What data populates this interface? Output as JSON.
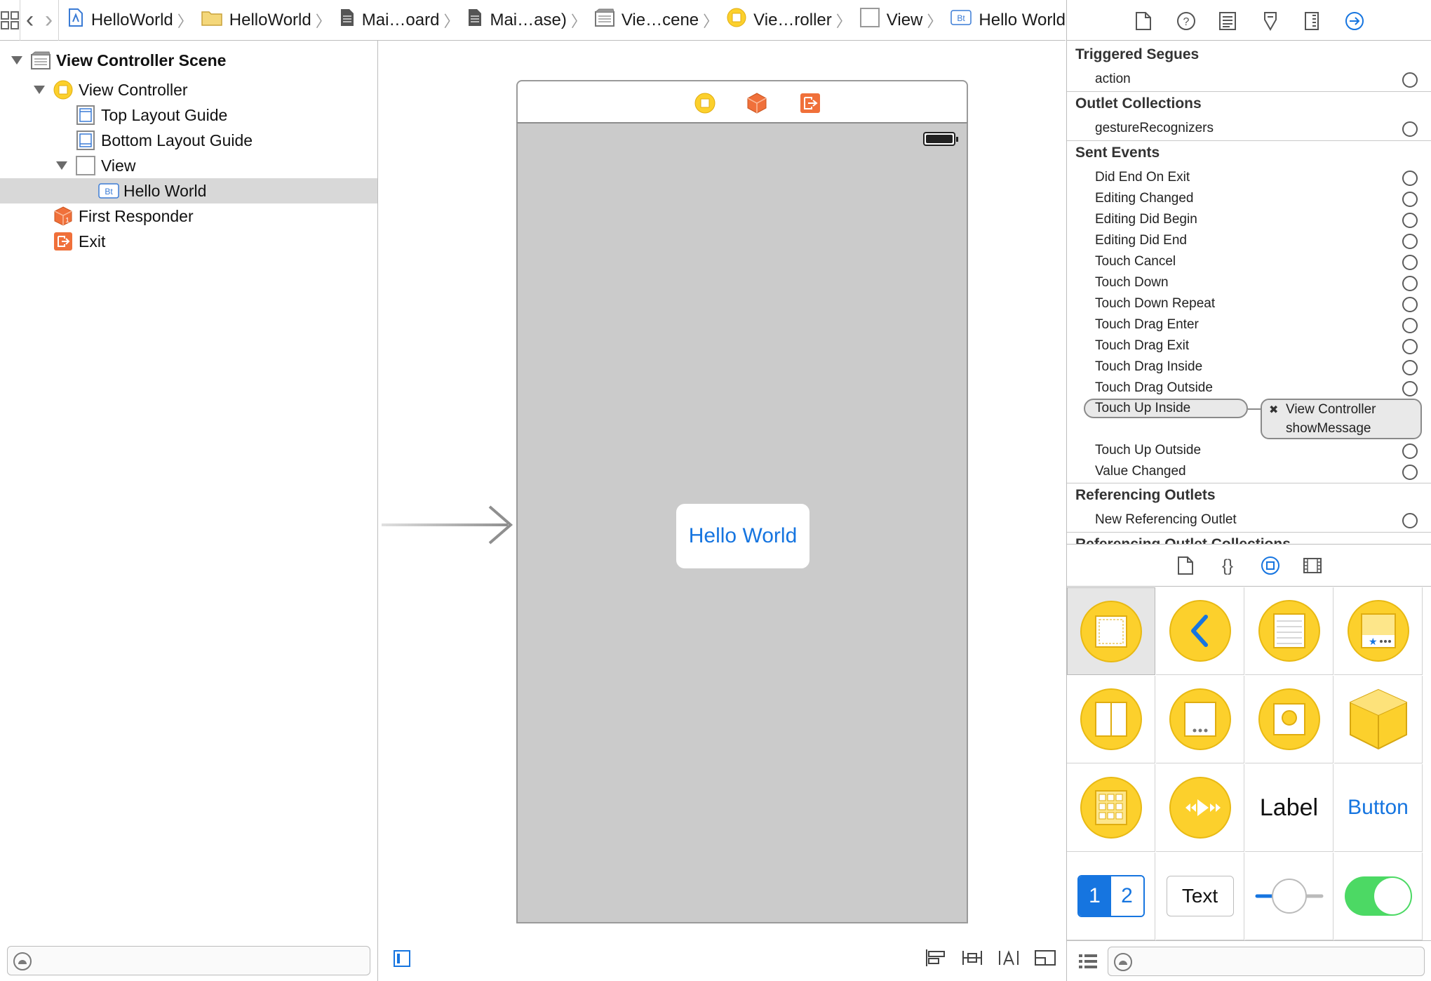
{
  "breadcrumbs": [
    {
      "label": "HelloWorld",
      "icon": "project-icon"
    },
    {
      "label": "HelloWorld",
      "icon": "folder-icon"
    },
    {
      "label": "Mai…oard",
      "icon": "storyboard-file-icon"
    },
    {
      "label": "Mai…ase)",
      "icon": "storyboard-file-icon"
    },
    {
      "label": "Vie…cene",
      "icon": "scene-icon"
    },
    {
      "label": "Vie…roller",
      "icon": "view-controller-icon"
    },
    {
      "label": "View",
      "icon": "view-icon"
    },
    {
      "label": "Hello World",
      "icon": "button-icon"
    }
  ],
  "outline": {
    "items": [
      {
        "label": "View Controller Scene",
        "icon": "scene-icon"
      },
      {
        "label": "View Controller",
        "icon": "view-controller-icon"
      },
      {
        "label": "Top Layout Guide",
        "icon": "layout-guide-icon"
      },
      {
        "label": "Bottom Layout Guide",
        "icon": "layout-guide-icon"
      },
      {
        "label": "View",
        "icon": "view-icon"
      },
      {
        "label": "Hello World",
        "icon": "button-icon",
        "badge": "Bt"
      },
      {
        "label": "First Responder",
        "icon": "first-responder-icon"
      },
      {
        "label": "Exit",
        "icon": "exit-icon"
      }
    ]
  },
  "canvas": {
    "button_title": "Hello World"
  },
  "inspector": {
    "triggered_segues": {
      "title": "Triggered Segues",
      "items": [
        "action"
      ]
    },
    "outlet_collections": {
      "title": "Outlet Collections",
      "items": [
        "gestureRecognizers"
      ]
    },
    "sent_events": {
      "title": "Sent Events",
      "items": [
        "Did End On Exit",
        "Editing Changed",
        "Editing Did Begin",
        "Editing Did End",
        "Touch Cancel",
        "Touch Down",
        "Touch Down Repeat",
        "Touch Drag Enter",
        "Touch Drag Exit",
        "Touch Drag Inside",
        "Touch Drag Outside",
        "Touch Up Inside",
        "Touch Up Outside",
        "Value Changed"
      ],
      "connection": {
        "event": "Touch Up Inside",
        "target": "View Controller",
        "action": "showMessage"
      }
    },
    "referencing_outlets": {
      "title": "Referencing Outlets",
      "items": [
        "New Referencing Outlet"
      ]
    },
    "referencing_outlet_collections": {
      "title": "Referencing Outlet Collections"
    }
  },
  "library": {
    "objects": [
      "view-controller",
      "navigation-controller",
      "table-view-controller",
      "tab-bar-controller",
      "page-view-controller",
      "glkit-view-controller",
      "avkit-player-view-controller",
      "object",
      "collection-view-controller",
      "av-player-controller",
      "label",
      "button",
      "segmented-control",
      "text-field",
      "slider",
      "switch"
    ],
    "label_text": "Label",
    "button_text": "Button",
    "segment_1": "1",
    "segment_2": "2",
    "text_field_text": "Text"
  },
  "colors": {
    "accent": "#1675e0",
    "library_yellow": "#fcd02c",
    "exit_orange": "#f0703a",
    "switch_green": "#4cd964"
  }
}
